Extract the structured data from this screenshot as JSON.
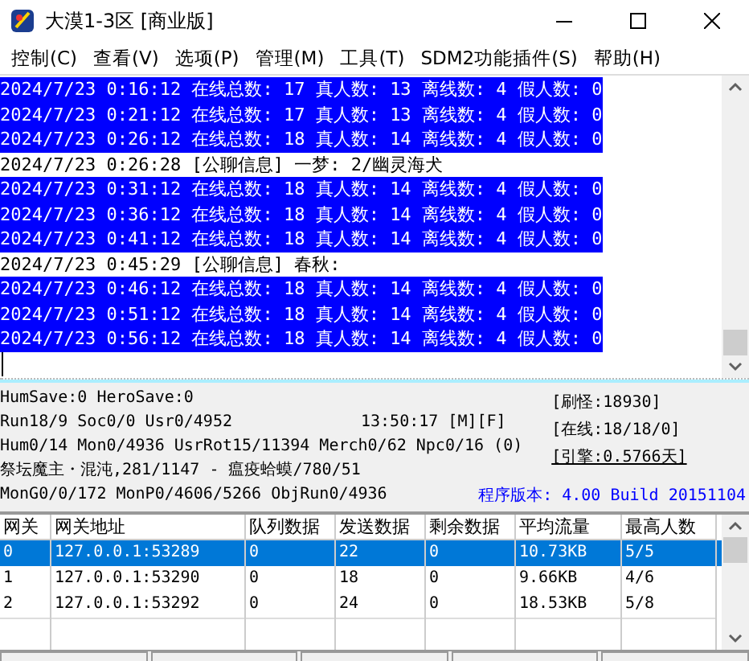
{
  "window": {
    "title": "大漠1-3区 [商业版]"
  },
  "menu": [
    "控制(C)",
    "查看(V)",
    "选项(P)",
    "管理(M)",
    "工具(T)",
    "SDM2功能插件(S)",
    "帮助(H)"
  ],
  "log": [
    {
      "text": "2024/7/23 0:16:12 在线总数: 17 真人数: 13 离线数: 4 假人数: 0",
      "selected": true
    },
    {
      "text": "2024/7/23 0:21:12 在线总数: 17 真人数: 13 离线数: 4 假人数: 0",
      "selected": true
    },
    {
      "text": "2024/7/23 0:26:12 在线总数: 18 真人数: 14 离线数: 4 假人数: 0",
      "selected": true
    },
    {
      "text": "2024/7/23 0:26:28 [公聊信息] 一梦: 2/幽灵海犬",
      "selected": false
    },
    {
      "text": "2024/7/23 0:31:12 在线总数: 18 真人数: 14 离线数: 4 假人数: 0",
      "selected": true
    },
    {
      "text": "2024/7/23 0:36:12 在线总数: 18 真人数: 14 离线数: 4 假人数: 0",
      "selected": true
    },
    {
      "text": "2024/7/23 0:41:12 在线总数: 18 真人数: 14 离线数: 4 假人数: 0",
      "selected": true
    },
    {
      "text": "2024/7/23 0:45:29 [公聊信息] 春秋:",
      "selected": false
    },
    {
      "text": "2024/7/23 0:46:12 在线总数: 18 真人数: 14 离线数: 4 假人数: 0",
      "selected": true
    },
    {
      "text": "2024/7/23 0:51:12 在线总数: 18 真人数: 14 离线数: 4 假人数: 0",
      "selected": true
    },
    {
      "text": "2024/7/23 0:56:12 在线总数: 18 真人数: 14 离线数: 4 假人数: 0",
      "selected": true
    }
  ],
  "status": {
    "lines": [
      "HumSave:0 HeroSave:0",
      "Run18/9 Soc0/0 Usr0/4952",
      "Hum0/14 Mon0/4936 UsrRot15/11394 Merch0/62 Npc0/16 (0)",
      "祭坛魔主・混沌,281/1147 - 瘟疫蛤蟆/780/51",
      "MonG0/0/172 MonP0/4606/5266 ObjRun0/4936"
    ],
    "clock": "13:50:17 [M][F]",
    "counters": [
      "[刷怪:18930]",
      "[在线:18/18/0]",
      "[引擎:0.5766天]"
    ],
    "version": "程序版本: 4.00 Build 20151104"
  },
  "table": {
    "columns": [
      "网关",
      "网关地址",
      "队列数据",
      "发送数据",
      "剩余数据",
      "平均流量",
      "最高人数"
    ],
    "rows": [
      {
        "cells": [
          "0",
          "127.0.0.1:53289",
          "0",
          "22",
          "0",
          "10.73KB",
          "5/5"
        ],
        "selected": true
      },
      {
        "cells": [
          "1",
          "127.0.0.1:53290",
          "0",
          "18",
          "0",
          "9.66KB",
          "4/6"
        ],
        "selected": false
      },
      {
        "cells": [
          "2",
          "127.0.0.1:53292",
          "0",
          "24",
          "0",
          "18.53KB",
          "5/8"
        ],
        "selected": false
      }
    ]
  }
}
